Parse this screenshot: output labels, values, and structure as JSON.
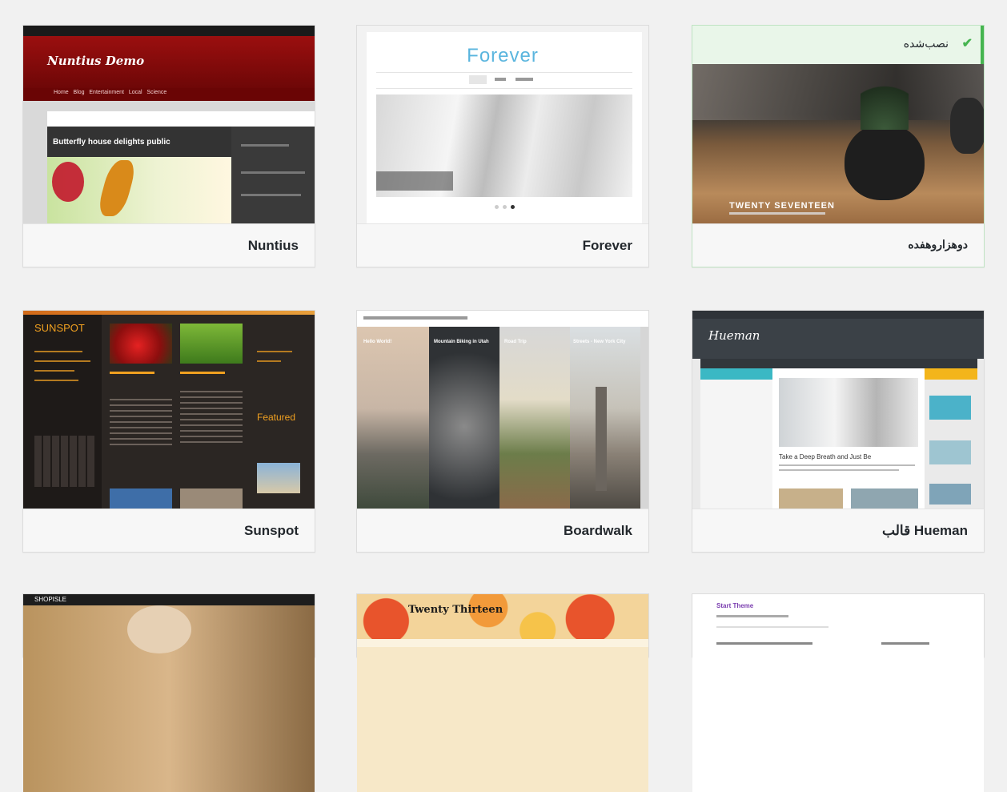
{
  "themes": [
    {
      "name": "Nuntius",
      "shot": {
        "title": "Nuntius Demo",
        "nav": [
          "Home",
          "Blog",
          "Entertainment",
          "Local",
          "Science"
        ],
        "post": "Butterfly house delights public"
      }
    },
    {
      "name": "Forever",
      "shot": {
        "title": "Forever"
      }
    },
    {
      "name": "دوهزاروهفده",
      "installed_label": "نصب‌شده",
      "shot": {
        "title": "TWENTY SEVENTEEN"
      }
    },
    {
      "name": "Sunspot",
      "shot": {
        "title": "SUNSPOT",
        "featured": "Featured"
      }
    },
    {
      "name": "Boardwalk",
      "shot": {
        "panels": [
          "Hello World!",
          "Mountain Biking in Utah",
          "Road Trip",
          "Streets - New York City"
        ]
      }
    },
    {
      "name": "قالب Hueman",
      "shot": {
        "title": "Hueman",
        "headline": "Take a Deep Breath and Just Be"
      }
    },
    {
      "name": "",
      "shot": {
        "title": "SHOPISLE"
      }
    },
    {
      "name": "",
      "shot": {
        "title": "Twenty Thirteen"
      }
    },
    {
      "name": "",
      "shot": {
        "title": "Start Theme"
      }
    }
  ],
  "colors": {
    "accent_green": "#46b450",
    "nuntius_red": "#8b0d0d",
    "hueman_teal": "#3bb8c4",
    "hueman_yellow": "#f3b51b"
  }
}
